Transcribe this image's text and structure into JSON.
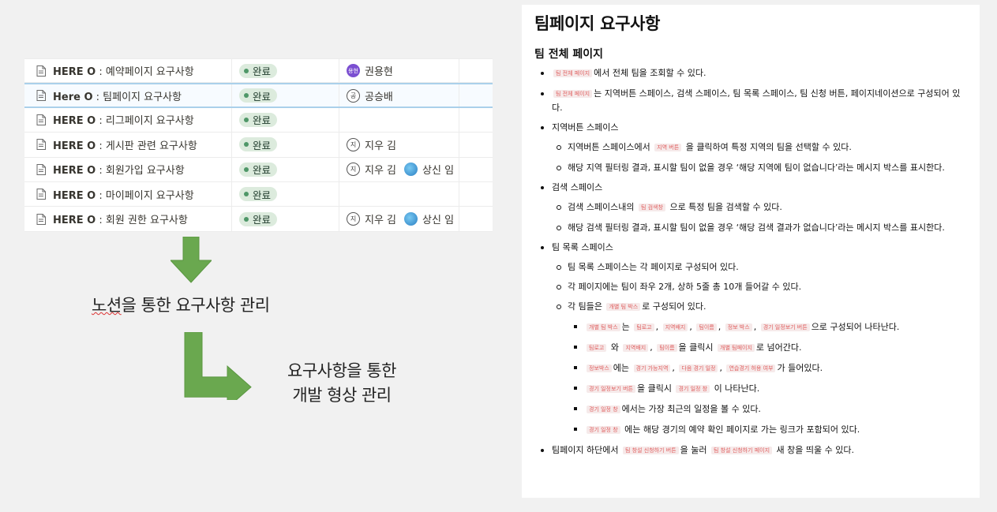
{
  "table": {
    "rows": [
      {
        "prefix": "HERE O",
        "name": " : 예약페이지 요구사항",
        "status": "완료",
        "people": [
          {
            "name": "권용현",
            "avatar": "용현",
            "style": "purple"
          }
        ]
      },
      {
        "prefix": "Here O",
        "name": " : 팀페이지 요구사항",
        "status": "완료",
        "people": [
          {
            "name": "공승배",
            "avatar": "공",
            "style": "outline"
          }
        ]
      },
      {
        "prefix": "HERE O",
        "name": " : 리그페이지 요구사항",
        "status": "완료",
        "people": []
      },
      {
        "prefix": "HERE O",
        "name": " : 게시판 관련 요구사항",
        "status": "완료",
        "people": [
          {
            "name": "지우 김",
            "avatar": "지",
            "style": "outline"
          }
        ]
      },
      {
        "prefix": "HERE O",
        "name": " : 회원가입 요구사항",
        "status": "완료",
        "people": [
          {
            "name": "지우 김",
            "avatar": "지",
            "style": "outline"
          },
          {
            "name": "상신 임",
            "avatar": "",
            "style": "globe"
          }
        ]
      },
      {
        "prefix": "HERE O",
        "name": " : 마이페이지 요구사항",
        "status": "완료",
        "people": []
      },
      {
        "prefix": "HERE O",
        "name": " : 회원 권한 요구사항",
        "status": "완료",
        "people": [
          {
            "name": "지우 김",
            "avatar": "지",
            "style": "outline"
          },
          {
            "name": "상신 임",
            "avatar": "",
            "style": "globe"
          }
        ]
      }
    ]
  },
  "captions": {
    "notion_pre": "노션",
    "notion_post": "을 통한 요구사항 관리",
    "line1": "요구사항을 통한",
    "line2": "개발 형상 관리"
  },
  "doc": {
    "title": "팀페이지 요구사항",
    "section": "팀 전체 페이지",
    "items": [
      {
        "parts": [
          [
            "c",
            "팀 전체 페이지"
          ],
          [
            "t",
            "에서 전체 팀을 조회할 수 있다."
          ]
        ]
      },
      {
        "parts": [
          [
            "c",
            "팀 전체 페이지"
          ],
          [
            "t",
            "는 지역버튼 스페이스, 검색 스페이스, 팀 목록 스페이스, 팀 신청 버튼, 페이지네이션으로 구성되어 있다."
          ]
        ]
      },
      {
        "parts": [
          [
            "t",
            "지역버튼 스페이스"
          ]
        ],
        "children": [
          {
            "parts": [
              [
                "t",
                "지역버튼 스페이스에서 "
              ],
              [
                "c",
                "지역 버튼"
              ],
              [
                "t",
                " 을 클릭하여 특정 지역의 팀을 선택할 수 있다."
              ]
            ]
          },
          {
            "parts": [
              [
                "t",
                "해당 지역 필터링 결과, 표시할 팀이 없을 경우 ‘해당 지역에 팀이 없습니다’라는 메시지 박스를 표시한다."
              ]
            ]
          }
        ]
      },
      {
        "parts": [
          [
            "t",
            "검색 스페이스"
          ]
        ],
        "children": [
          {
            "parts": [
              [
                "t",
                "검색 스페이스내의 "
              ],
              [
                "c",
                "팀 검색창"
              ],
              [
                "t",
                " 으로 특정 팀을 검색할 수 있다."
              ]
            ]
          },
          {
            "parts": [
              [
                "t",
                "해당 검색 필터링 결과, 표시할 팀이 없을 경우 ‘해당 검색 결과가  없습니다’라는 메시지 박스를 표시한다."
              ]
            ]
          }
        ]
      },
      {
        "parts": [
          [
            "t",
            "팀 목록 스페이스"
          ]
        ],
        "children": [
          {
            "parts": [
              [
                "t",
                "팀 목록 스페이스는 각 페이지로 구성되어 있다."
              ]
            ]
          },
          {
            "parts": [
              [
                "t",
                "각 페이지에는 팀이 좌우 2개, 상하 5줄 총 10개 들어갈 수 있다."
              ]
            ]
          },
          {
            "parts": [
              [
                "t",
                "각 팀들은 "
              ],
              [
                "c",
                "개별 팀 박스"
              ],
              [
                "t",
                "로 구성되어 있다."
              ]
            ],
            "children": [
              {
                "parts": [
                  [
                    "c",
                    "개별 팀 박스"
                  ],
                  [
                    "t",
                    "는 "
                  ],
                  [
                    "c",
                    "팀로고"
                  ],
                  [
                    "t",
                    ", "
                  ],
                  [
                    "c",
                    "지역배지"
                  ],
                  [
                    "t",
                    ", "
                  ],
                  [
                    "c",
                    "팀이름"
                  ],
                  [
                    "t",
                    ", "
                  ],
                  [
                    "c",
                    "정보 박스"
                  ],
                  [
                    "t",
                    ", "
                  ],
                  [
                    "c",
                    "경기 일정보기 버튼"
                  ],
                  [
                    "t",
                    "으로 구성되어 나타난다."
                  ]
                ]
              },
              {
                "parts": [
                  [
                    "c",
                    "팀로고"
                  ],
                  [
                    "t",
                    " 와 "
                  ],
                  [
                    "c",
                    "지역배지"
                  ],
                  [
                    "t",
                    ", "
                  ],
                  [
                    "c",
                    "팀이름"
                  ],
                  [
                    "t",
                    "을 클릭시 "
                  ],
                  [
                    "c",
                    "개별 팀페이지"
                  ],
                  [
                    "t",
                    "로 넘어간다."
                  ]
                ]
              },
              {
                "parts": [
                  [
                    "c",
                    "정보박스"
                  ],
                  [
                    "t",
                    "에는 "
                  ],
                  [
                    "c",
                    "경기 가능지역"
                  ],
                  [
                    "t",
                    ", "
                  ],
                  [
                    "c",
                    "다음 경기 일정"
                  ],
                  [
                    "t",
                    ", "
                  ],
                  [
                    "c",
                    "연습경기 허용 여부"
                  ],
                  [
                    "t",
                    "가 들어있다."
                  ]
                ]
              },
              {
                "parts": [
                  [
                    "c",
                    "경기 일정보기 버튼"
                  ],
                  [
                    "t",
                    "을 클릭시 "
                  ],
                  [
                    "c",
                    "경기 일정 창"
                  ],
                  [
                    "t",
                    " 이 나타난다."
                  ]
                ]
              },
              {
                "parts": [
                  [
                    "c",
                    "경기 일정 창"
                  ],
                  [
                    "t",
                    "에서는 가장 최근의 일정을 볼 수 있다."
                  ]
                ]
              },
              {
                "parts": [
                  [
                    "c",
                    "경기 일정 창"
                  ],
                  [
                    "t",
                    " 에는 해당 경기의 예약 확인 페이지로 가는 링크가 포함되어 있다."
                  ]
                ]
              }
            ]
          }
        ]
      },
      {
        "parts": [
          [
            "t",
            "팀페이지 하단에서 "
          ],
          [
            "c",
            "팀 창설 신청하기 버튼"
          ],
          [
            "t",
            "을 눌러 "
          ],
          [
            "c",
            "팀 창설 신청하기 페이지"
          ],
          [
            "t",
            " 새 창을 띄울 수 있다."
          ]
        ]
      }
    ]
  },
  "colors": {
    "arrow": "#6aa84f",
    "badge_bg": "#dcebdd",
    "code_text": "#e06060"
  }
}
